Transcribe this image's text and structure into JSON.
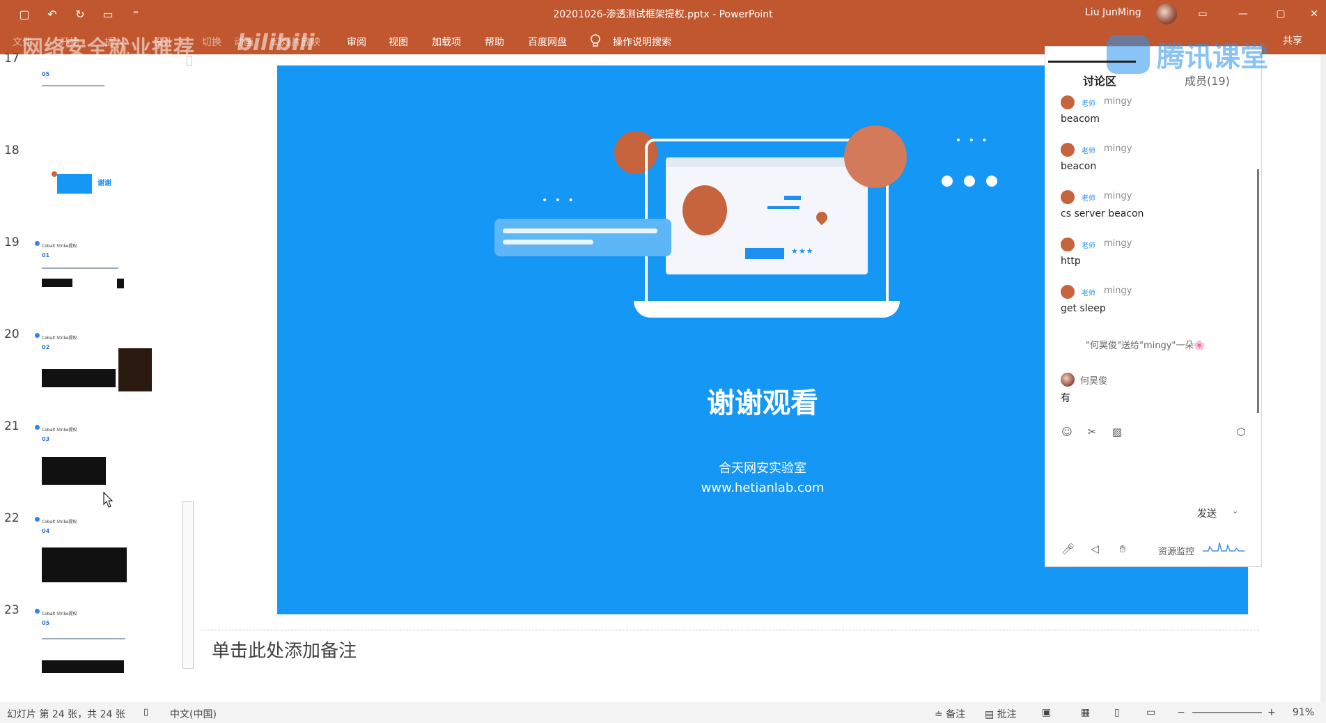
{
  "titlebar": {
    "doc_title": "20201026-渗透测试框架提权.pptx - PowerPoint",
    "user_name": "Liu JunMing",
    "qat": {
      "save": "▢",
      "undo": "↶",
      "redo": "↻",
      "present": "▭",
      "customize": "⁼"
    },
    "win": {
      "ribbon_options": "▭",
      "minimize": "—",
      "maximize": "▢",
      "close": "✕"
    }
  },
  "ribbon": {
    "tabs": [
      "文件",
      "开始",
      "插入",
      "设计",
      "切换",
      "动画",
      "幻灯片放映",
      "审阅",
      "视图",
      "加载项",
      "帮助",
      "百度网盘"
    ],
    "tell_me": "操作说明搜索",
    "share": "共享",
    "watermark": "网络安全就业推荐",
    "watermark_logo": "bilibili"
  },
  "thumbnails": {
    "items": [
      {
        "num": "17",
        "head": "",
        "sub": "05"
      },
      {
        "num": "18",
        "head": "",
        "sub": "谢谢"
      },
      {
        "num": "19",
        "head": "Cobalt Strike提权",
        "sub": "01"
      },
      {
        "num": "20",
        "head": "Cobalt Strike提权",
        "sub": "02"
      },
      {
        "num": "21",
        "head": "Cobalt Strike提权",
        "sub": "03"
      },
      {
        "num": "22",
        "head": "Cobalt Strike提权",
        "sub": "04"
      },
      {
        "num": "23",
        "head": "Cobalt Strike提权",
        "sub": "05"
      }
    ]
  },
  "slide": {
    "thanks": "谢谢观看",
    "lab": "合天网安实验室",
    "url": "www.hetianlab.com",
    "stars": "★★★",
    "dots": "• • •"
  },
  "notes": {
    "placeholder": "单击此处添加备注"
  },
  "statusbar": {
    "slide_info": "幻灯片 第 24 张，共 24 张",
    "language": "中文(中国)",
    "notes_btn": "≐ 备注",
    "comments_btn": "▤ 批注",
    "zoom": "91%"
  },
  "panel": {
    "brand": "腾讯课堂",
    "tab_discuss": "讨论区",
    "tab_members": "成员(19)",
    "messages": [
      {
        "role": "老师",
        "name": "mingy",
        "text": "beacom"
      },
      {
        "role": "老师",
        "name": "mingy",
        "text": "beacon"
      },
      {
        "role": "老师",
        "name": "mingy",
        "text": "cs server  beacon"
      },
      {
        "role": "老师",
        "name": "mingy",
        "text": "http"
      },
      {
        "role": "老师",
        "name": "mingy",
        "text": "get sleep"
      }
    ],
    "gift": "\"何昊俊\"送给\"mingy\"一朵🌸",
    "student": {
      "name": "何昊俊",
      "text": "有"
    },
    "send": "发送",
    "send_arrow": "⌄",
    "monitor": "资源监控"
  },
  "colors": {
    "ribbon": "#c0572f",
    "slide_bg": "#1497f5",
    "accent_orange": "#c5643d",
    "brand_blue": "#2a93ee"
  }
}
